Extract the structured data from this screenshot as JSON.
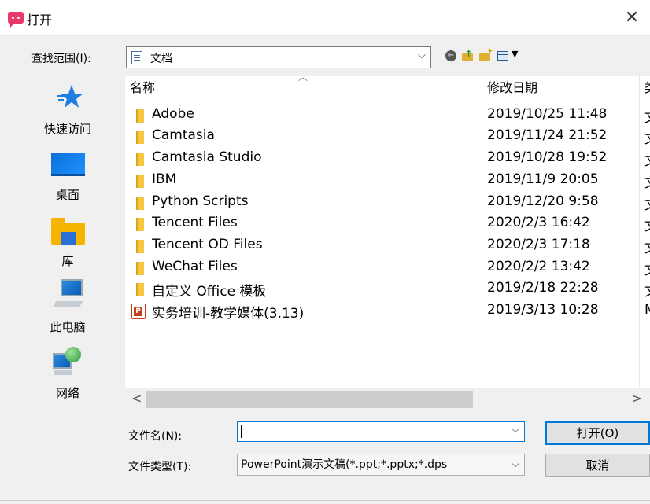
{
  "window": {
    "title": "打开",
    "close_glyph": "✕"
  },
  "lookin": {
    "label": "查找范围(I):",
    "value": "文档",
    "arrow": "⌵"
  },
  "toolbar": {
    "back_glyph": "←",
    "views_caret": "▼"
  },
  "places": [
    {
      "label": "快速访问",
      "icon": "star-icon"
    },
    {
      "label": "桌面",
      "icon": "desktop-icon"
    },
    {
      "label": "库",
      "icon": "library-icon"
    },
    {
      "label": "此电脑",
      "icon": "computer-icon"
    },
    {
      "label": "网络",
      "icon": "network-icon"
    }
  ],
  "filelist": {
    "columns": {
      "name": "名称",
      "date": "修改日期",
      "type": "类"
    },
    "sort_caret": "︿",
    "rows": [
      {
        "name": "Adobe",
        "date": "2019/10/25 11:48",
        "type": "文",
        "kind": "folder"
      },
      {
        "name": "Camtasia",
        "date": "2019/11/24 21:52",
        "type": "文",
        "kind": "folder"
      },
      {
        "name": "Camtasia Studio",
        "date": "2019/10/28 19:52",
        "type": "文",
        "kind": "folder"
      },
      {
        "name": "IBM",
        "date": "2019/11/9 20:05",
        "type": "文",
        "kind": "folder"
      },
      {
        "name": "Python Scripts",
        "date": "2019/12/20 9:58",
        "type": "文",
        "kind": "folder"
      },
      {
        "name": "Tencent Files",
        "date": "2020/2/3 16:42",
        "type": "文",
        "kind": "folder"
      },
      {
        "name": "Tencent OD Files",
        "date": "2020/2/3 17:18",
        "type": "文",
        "kind": "folder"
      },
      {
        "name": "WeChat Files",
        "date": "2020/2/2 13:42",
        "type": "文",
        "kind": "folder"
      },
      {
        "name": "自定义 Office 模板",
        "date": "2019/2/18 22:28",
        "type": "文",
        "kind": "folder"
      },
      {
        "name": "实务培训-教学媒体(3.13)",
        "date": "2019/3/13 10:28",
        "type": "M",
        "kind": "ppt"
      }
    ],
    "scroll_left": "<",
    "scroll_right": ">"
  },
  "filename": {
    "label": "文件名(N):",
    "value": "",
    "arrow": "⌵"
  },
  "filetype": {
    "label": "文件类型(T):",
    "value": "PowerPoint演示文稿(*.ppt;*.pptx;*.dps",
    "arrow": "⌵"
  },
  "buttons": {
    "open": "打开(O)",
    "cancel": "取消"
  }
}
